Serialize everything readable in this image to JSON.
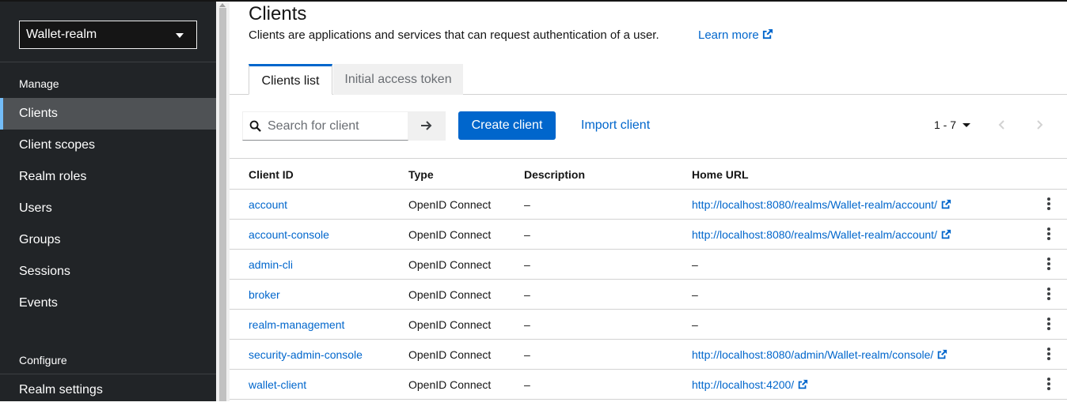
{
  "sidebar": {
    "realm": "Wallet-realm",
    "section_manage": "Manage",
    "items": [
      {
        "label": "Clients"
      },
      {
        "label": "Client scopes"
      },
      {
        "label": "Realm roles"
      },
      {
        "label": "Users"
      },
      {
        "label": "Groups"
      },
      {
        "label": "Sessions"
      },
      {
        "label": "Events"
      }
    ],
    "section_configure": "Configure",
    "configure_items": [
      {
        "label": "Realm settings"
      }
    ]
  },
  "page": {
    "title": "Clients",
    "description": "Clients are applications and services that can request authentication of a user.",
    "learn_more": "Learn more"
  },
  "tabs": [
    {
      "label": "Clients list"
    },
    {
      "label": "Initial access token"
    }
  ],
  "toolbar": {
    "search_placeholder": "Search for client",
    "create_label": "Create client",
    "import_label": "Import client",
    "pagination": "1 - 7"
  },
  "table": {
    "columns": [
      "Client ID",
      "Type",
      "Description",
      "Home URL"
    ],
    "rows": [
      {
        "id": "account",
        "type": "OpenID Connect",
        "description": "–",
        "url": "http://localhost:8080/realms/Wallet-realm/account/"
      },
      {
        "id": "account-console",
        "type": "OpenID Connect",
        "description": "–",
        "url": "http://localhost:8080/realms/Wallet-realm/account/"
      },
      {
        "id": "admin-cli",
        "type": "OpenID Connect",
        "description": "–",
        "url": "–"
      },
      {
        "id": "broker",
        "type": "OpenID Connect",
        "description": "–",
        "url": "–"
      },
      {
        "id": "realm-management",
        "type": "OpenID Connect",
        "description": "–",
        "url": "–"
      },
      {
        "id": "security-admin-console",
        "type": "OpenID Connect",
        "description": "–",
        "url": "http://localhost:8080/admin/Wallet-realm/console/"
      },
      {
        "id": "wallet-client",
        "type": "OpenID Connect",
        "description": "–",
        "url": "http://localhost:4200/"
      }
    ]
  },
  "colors": {
    "sidebar_bg": "#212427",
    "active_nav_bg": "#4f5255",
    "active_nav_accent": "#73bcf7",
    "primary": "#0066cc",
    "link": "#0066cc"
  }
}
